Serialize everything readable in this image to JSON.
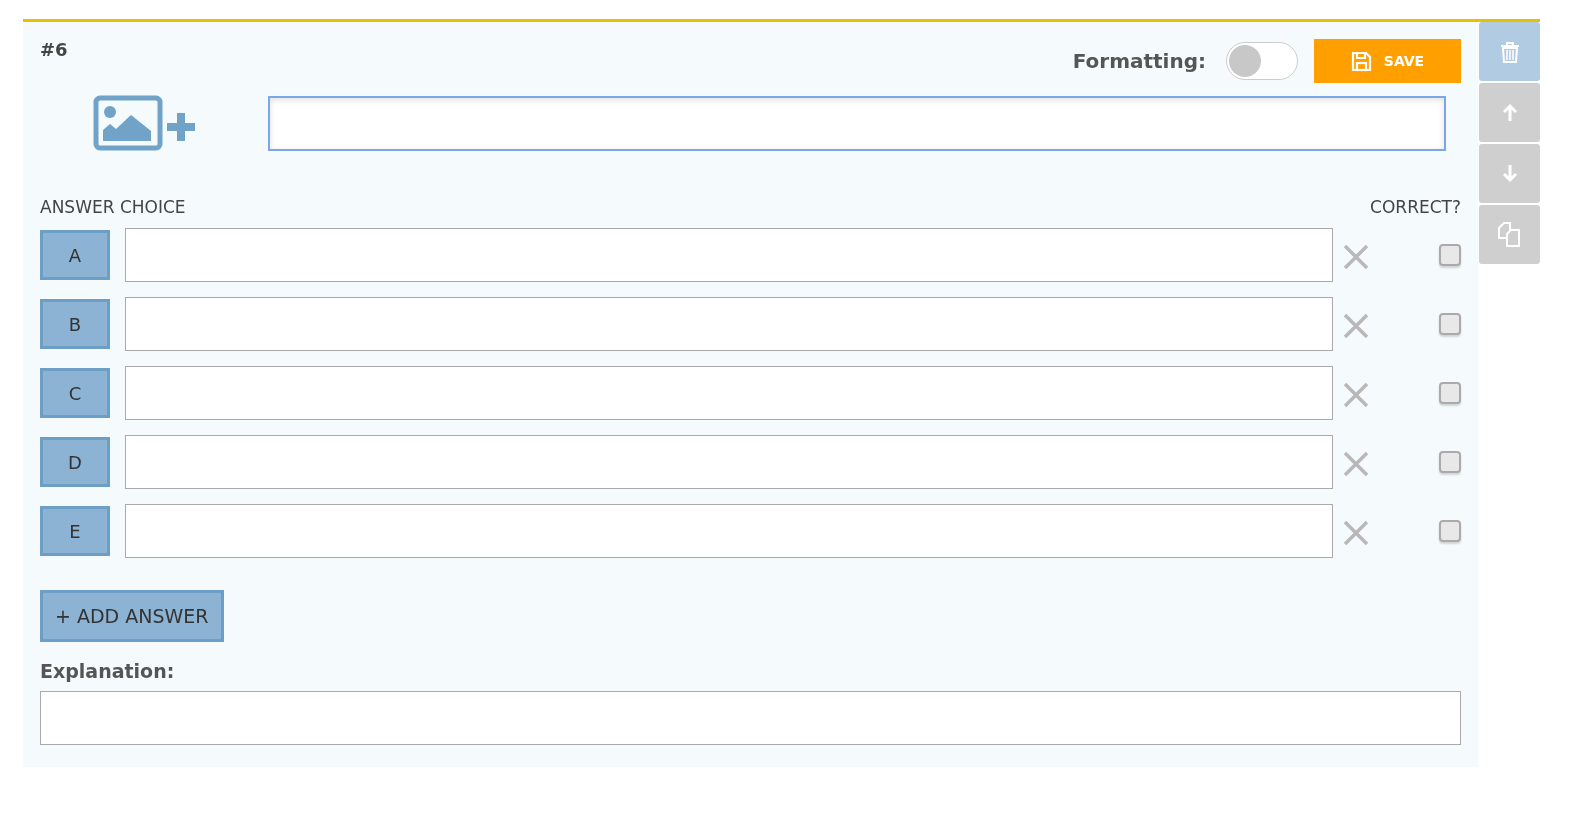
{
  "question_number": "#6",
  "formatting": {
    "label": "Formatting:",
    "on": false
  },
  "save_button": {
    "label": "SAVE"
  },
  "question_field": {
    "focused": true
  },
  "headers": {
    "answer_choice": "ANSWER CHOICE",
    "correct": "CORRECT?"
  },
  "answers": [
    {
      "letter": "A",
      "checked": false
    },
    {
      "letter": "B",
      "checked": false
    },
    {
      "letter": "C",
      "checked": false
    },
    {
      "letter": "D",
      "checked": false
    },
    {
      "letter": "E",
      "checked": false
    }
  ],
  "add_answer": {
    "label": "+ ADD ANSWER"
  },
  "explanation": {
    "label": "Explanation:"
  },
  "tools": [
    {
      "kind": "delete",
      "active": true
    },
    {
      "kind": "up",
      "active": false
    },
    {
      "kind": "down",
      "active": false
    },
    {
      "kind": "copy",
      "active": false
    }
  ]
}
